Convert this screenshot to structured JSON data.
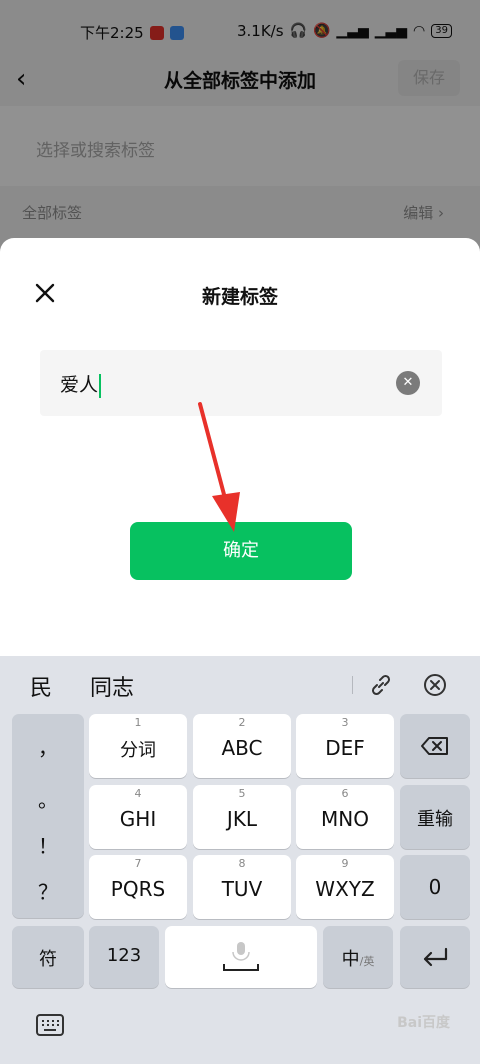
{
  "status_bar": {
    "time": "下午2:25",
    "speed": "3.1K/s",
    "battery": "39"
  },
  "nav": {
    "title": "从全部标签中添加",
    "save": "保存"
  },
  "search": {
    "placeholder": "选择或搜索标签"
  },
  "all_tags": {
    "label": "全部标签",
    "edit": "编辑 ›"
  },
  "sheet": {
    "title": "新建标签",
    "value": "爱人",
    "confirm": "确定"
  },
  "keyboard": {
    "candidates": [
      "民",
      "同志"
    ],
    "punct": [
      "，",
      "。",
      "！",
      "？"
    ],
    "rows": [
      [
        {
          "num": "1",
          "label": "分词"
        },
        {
          "num": "2",
          "label": "ABC"
        },
        {
          "num": "3",
          "label": "DEF"
        }
      ],
      [
        {
          "num": "4",
          "label": "GHI"
        },
        {
          "num": "5",
          "label": "JKL"
        },
        {
          "num": "6",
          "label": "MNO"
        }
      ],
      [
        {
          "num": "7",
          "label": "PQRS"
        },
        {
          "num": "8",
          "label": "TUV"
        },
        {
          "num": "9",
          "label": "WXYZ"
        }
      ]
    ],
    "reinput": "重输",
    "zero": "0",
    "symbols": "符",
    "num123": "123",
    "zh": "中",
    "en": "/英"
  },
  "watermark": "Bai百度"
}
